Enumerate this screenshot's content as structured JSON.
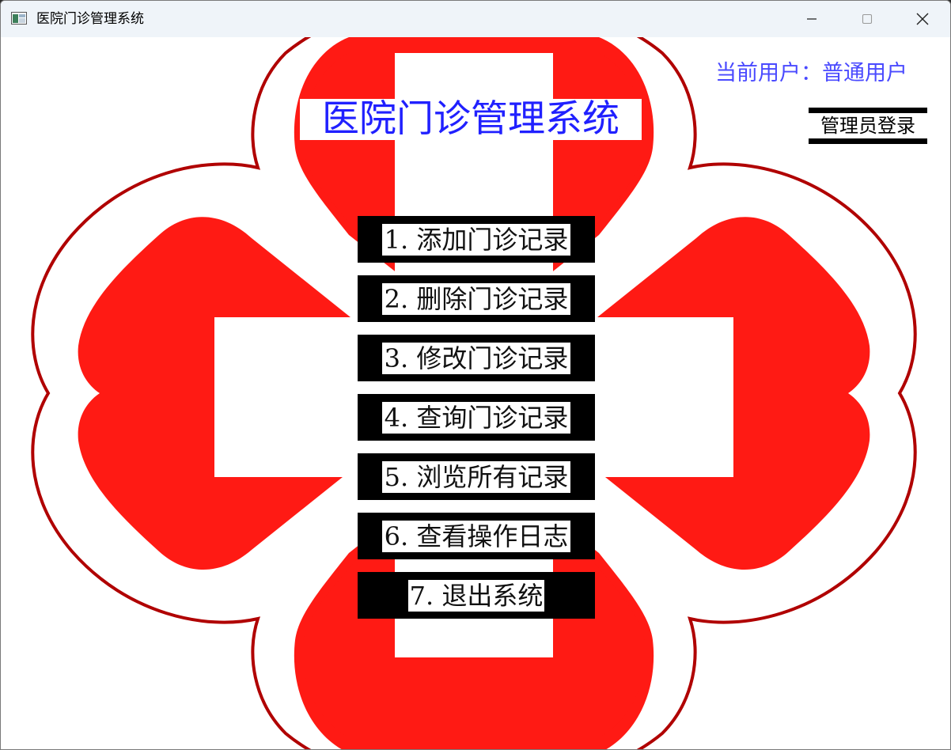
{
  "window": {
    "title": "医院门诊管理系统"
  },
  "header": {
    "main_title": "医院门诊管理系统",
    "user_status": "当前用户：普通用户",
    "admin_login_label": "管理员登录"
  },
  "menu": {
    "items": [
      {
        "label": "1. 添加门诊记录"
      },
      {
        "label": "2. 删除门诊记录"
      },
      {
        "label": "3. 修改门诊记录"
      },
      {
        "label": "4. 查询门诊记录"
      },
      {
        "label": "5. 浏览所有记录"
      },
      {
        "label": "6. 查看操作日志"
      },
      {
        "label": "7. 退出系统"
      }
    ]
  },
  "colors": {
    "logo_red": "#ff1a14",
    "logo_outline": "#b00000",
    "title_blue": "#2020ff",
    "user_status_blue": "#4a4aff",
    "titlebar_bg": "#eff4f9"
  },
  "icons": {
    "app": "app-window-icon",
    "minimize": "minimize-icon",
    "maximize": "maximize-icon",
    "close": "close-icon",
    "background": "hospital-cross-logo"
  }
}
